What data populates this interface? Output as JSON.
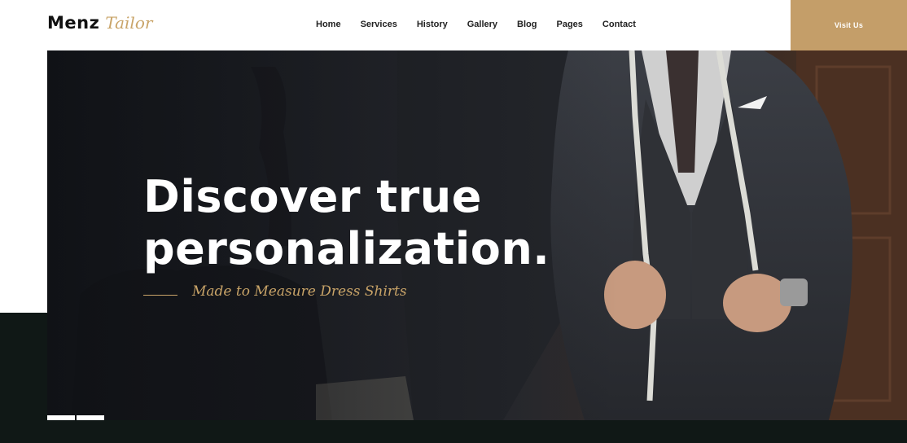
{
  "brand": {
    "name": "Menz",
    "tagline": "Tailor"
  },
  "nav": {
    "items": [
      {
        "label": "Home"
      },
      {
        "label": "Services"
      },
      {
        "label": "History"
      },
      {
        "label": "Gallery"
      },
      {
        "label": "Blog"
      },
      {
        "label": "Pages"
      },
      {
        "label": "Contact"
      }
    ],
    "cta_label": "Visit Us"
  },
  "hero": {
    "title_line1": "Discover true",
    "title_line2": "personalization.",
    "subtitle": "Made to Measure Dress Shirts",
    "slide_count": 2
  },
  "colors": {
    "accent": "#c49e69",
    "dark": "#101816",
    "text": "#222222"
  }
}
